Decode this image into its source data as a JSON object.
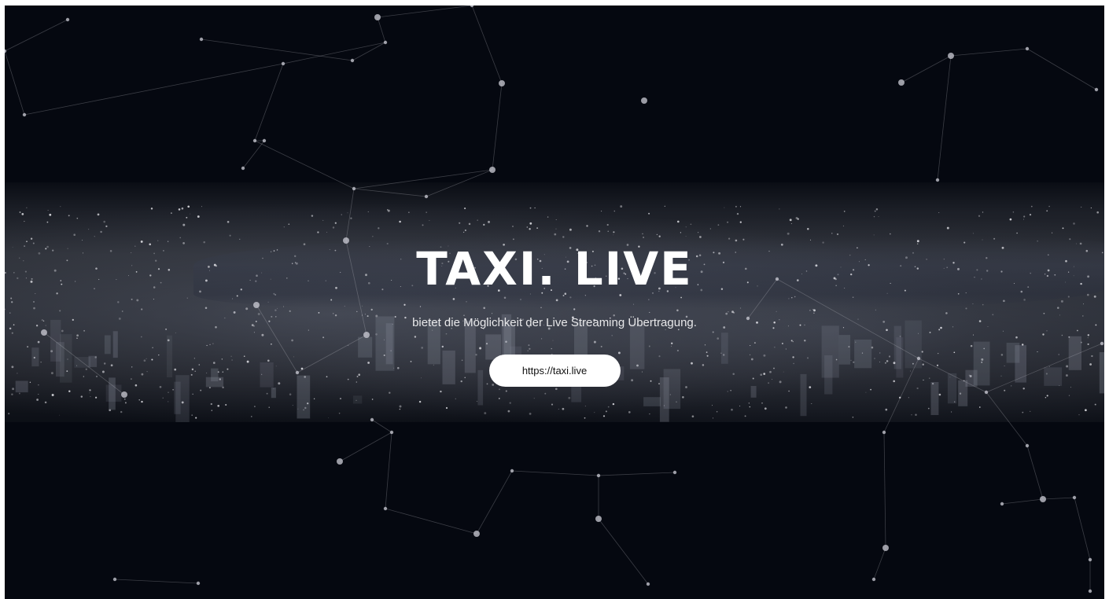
{
  "hero": {
    "title": "TAXI. LIVE",
    "subtitle": "bietet die Möglichkeit der Live Streaming Übertragung.",
    "button_label": "https://taxi.live"
  },
  "colors": {
    "background": "#050810",
    "title": "#ffffff",
    "button_bg": "#ffffff",
    "button_text": "#111111"
  },
  "background_image": "night-city-skyline",
  "decoration": "network-constellation-lines"
}
